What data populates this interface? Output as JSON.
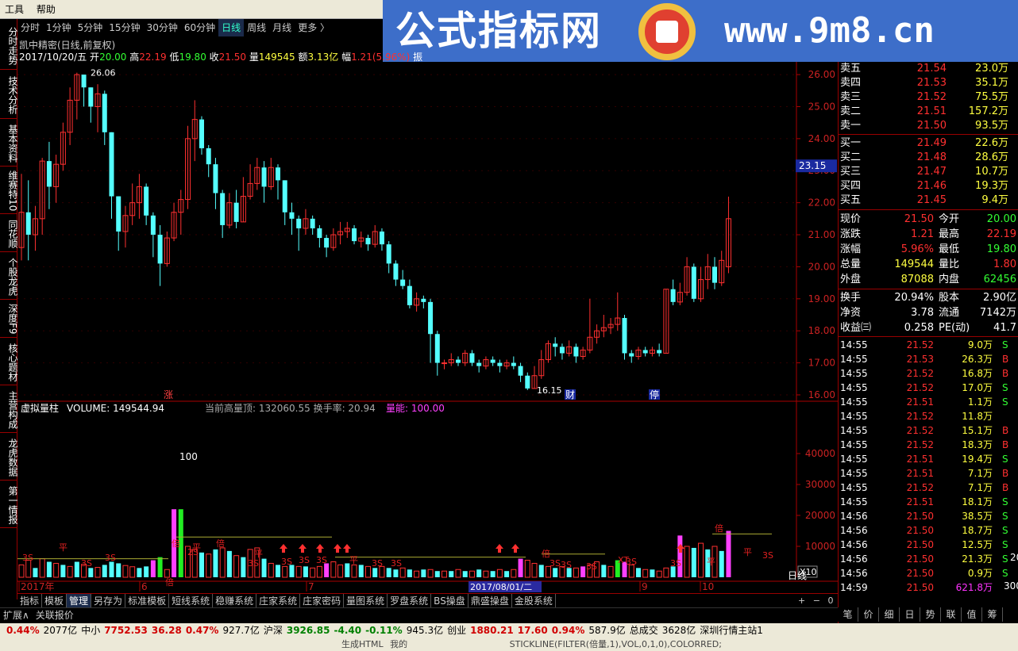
{
  "menu": [
    "工具",
    "帮助"
  ],
  "banner": {
    "cn": "公式指标网",
    "url": "www.9m8.cn",
    "logo_text": "www.9m8.cn"
  },
  "left_tabs": [
    "分时走势",
    "技术分析",
    "基本资料",
    "维赛特10",
    "同花顺",
    "个股龙虎",
    "深度F9",
    "核心题材",
    "主营构成",
    "龙虎数据",
    "第一情报"
  ],
  "timeframes": [
    "分时",
    "1分钟",
    "5分钟",
    "15分钟",
    "30分钟",
    "60分钟",
    "日线",
    "周线",
    "月线",
    "更多 〉"
  ],
  "active_timeframe": "日线",
  "stock_title": "凯中精密(日线,前复权)",
  "info": {
    "date": "2017/10/20/五",
    "open_l": "开",
    "open": "20.00",
    "high_l": "高",
    "high": "22.19",
    "low_l": "低",
    "low": "19.80",
    "close_l": "收",
    "close": "21.50",
    "vol_l": "量",
    "vol": "149545",
    "amt_l": "额",
    "amt": "3.13亿",
    "chg_l": "幅",
    "chg": "1.21(5.96%)",
    "extra": "振"
  },
  "price_axis": [
    "26.00",
    "25.00",
    "24.00",
    "23.00",
    "22.00",
    "21.00",
    "20.00",
    "19.00",
    "18.00",
    "17.00",
    "16.00"
  ],
  "current_price_tag": "23.15",
  "annot": {
    "high": "26.06",
    "low": "16.15",
    "zhang": "涨",
    "cai": "财",
    "ting": "停",
    "hundred": "100"
  },
  "volume_header": {
    "name": "虚拟量柱",
    "vol": "VOLUME: 149544.94",
    "mid": "当前高量顶: 132060.55  换手率: 20.94",
    "lianneng": "量能: 100.00"
  },
  "volume_axis": [
    "40000",
    "30000",
    "20000",
    "10000"
  ],
  "x10": "X10",
  "dates": {
    "d1": "2017年",
    "d2": "6",
    "d3": "7",
    "d4": "2017/08/01/二",
    "d5": "9",
    "d6": "10"
  },
  "vol_labels": [
    "3S",
    "平",
    "3S",
    "3S",
    "倍",
    "倍",
    "2S",
    "平",
    "倍",
    "3S",
    "平",
    "3S",
    "3S",
    "3S",
    "平",
    "3S",
    "3S",
    "倍",
    "3S",
    "3S",
    "3S",
    "XT",
    "3S",
    "3S",
    "平",
    "倍",
    "平",
    "3S"
  ],
  "chart_data": {
    "type": "candlestick",
    "ylim": [
      16,
      26.06
    ],
    "candles": [
      [
        20.6,
        21.7,
        20.2,
        22.9
      ],
      [
        21.7,
        21.0,
        20.2,
        22.7
      ],
      [
        21.0,
        21.5,
        20.5,
        21.9
      ],
      [
        21.5,
        23.3,
        21.0,
        23.4
      ],
      [
        23.3,
        22.5,
        21.8,
        23.9
      ],
      [
        22.5,
        23.2,
        22.0,
        23.5
      ],
      [
        23.2,
        24.2,
        23.0,
        24.5
      ],
      [
        24.2,
        25.2,
        23.8,
        25.6
      ],
      [
        25.2,
        26.0,
        24.6,
        26.06
      ],
      [
        26.0,
        25.6,
        25.0,
        26.0
      ],
      [
        25.6,
        25.0,
        24.5,
        25.6
      ],
      [
        25.0,
        25.4,
        24.2,
        25.7
      ],
      [
        25.4,
        24.2,
        23.8,
        25.5
      ],
      [
        24.2,
        22.2,
        21.5,
        24.2
      ],
      [
        22.2,
        21.1,
        20.5,
        22.2
      ],
      [
        21.1,
        21.6,
        20.6,
        21.9
      ],
      [
        21.6,
        22.0,
        21.3,
        22.6
      ],
      [
        22.0,
        22.5,
        21.5,
        22.9
      ],
      [
        22.5,
        21.6,
        21.3,
        22.6
      ],
      [
        21.6,
        21.0,
        20.3,
        21.7
      ],
      [
        21.0,
        20.1,
        19.4,
        21.3
      ],
      [
        20.1,
        20.9,
        20.0,
        21.1
      ],
      [
        20.9,
        21.7,
        20.8,
        22.0
      ],
      [
        21.7,
        22.1,
        21.0,
        22.4
      ],
      [
        22.1,
        24.0,
        21.8,
        24.4
      ],
      [
        24.0,
        24.6,
        23.3,
        25.2
      ],
      [
        24.6,
        23.7,
        23.5,
        24.7
      ],
      [
        23.7,
        23.2,
        22.8,
        23.8
      ],
      [
        23.2,
        22.3,
        21.8,
        23.4
      ],
      [
        22.3,
        21.3,
        20.9,
        22.4
      ],
      [
        21.3,
        22.0,
        21.2,
        22.3
      ],
      [
        22.0,
        21.4,
        21.2,
        22.4
      ],
      [
        21.4,
        22.2,
        21.4,
        22.8
      ],
      [
        22.2,
        22.6,
        22.1,
        23.2
      ],
      [
        22.6,
        23.1,
        22.4,
        23.4
      ],
      [
        23.1,
        22.5,
        22.0,
        23.3
      ],
      [
        22.5,
        23.1,
        22.4,
        23.4
      ],
      [
        23.1,
        22.7,
        22.1,
        23.2
      ],
      [
        22.7,
        21.7,
        21.3,
        22.7
      ],
      [
        21.7,
        21.5,
        21.0,
        22.0
      ],
      [
        21.5,
        21.2,
        20.5,
        21.6
      ],
      [
        21.2,
        21.5,
        21.0,
        21.8
      ],
      [
        21.5,
        21.2,
        21.0,
        21.6
      ],
      [
        21.2,
        20.9,
        20.6,
        21.3
      ],
      [
        20.9,
        20.6,
        20.3,
        21.0
      ],
      [
        20.6,
        21.0,
        20.5,
        21.2
      ],
      [
        21.0,
        21.1,
        20.7,
        21.4
      ],
      [
        21.1,
        21.2,
        20.9,
        21.4
      ],
      [
        21.2,
        20.8,
        20.7,
        21.3
      ],
      [
        20.8,
        20.9,
        20.6,
        21.1
      ],
      [
        20.9,
        20.7,
        20.5,
        21.0
      ],
      [
        20.7,
        21.1,
        20.6,
        21.3
      ],
      [
        21.1,
        20.7,
        20.5,
        21.2
      ],
      [
        20.7,
        20.1,
        19.8,
        20.8
      ],
      [
        20.1,
        19.6,
        19.4,
        20.2
      ],
      [
        19.6,
        19.4,
        19.3,
        19.9
      ],
      [
        19.4,
        18.8,
        18.7,
        19.6
      ],
      [
        18.8,
        19.0,
        18.6,
        19.2
      ],
      [
        19.0,
        18.9,
        18.7,
        19.1
      ],
      [
        18.9,
        17.9,
        17.0,
        19.0
      ],
      [
        17.9,
        17.0,
        16.6,
        18.0
      ],
      [
        17.0,
        17.0,
        16.8,
        17.1
      ],
      [
        17.0,
        17.1,
        16.9,
        17.3
      ],
      [
        17.1,
        17.0,
        16.9,
        17.2
      ],
      [
        17.0,
        17.3,
        16.9,
        17.4
      ],
      [
        17.3,
        17.0,
        16.9,
        17.4
      ],
      [
        17.0,
        16.9,
        16.7,
        17.1
      ],
      [
        16.9,
        17.1,
        16.8,
        17.2
      ],
      [
        17.1,
        17.0,
        16.9,
        17.2
      ],
      [
        17.0,
        16.9,
        16.7,
        17.1
      ],
      [
        16.9,
        17.0,
        16.8,
        17.1
      ],
      [
        17.0,
        16.9,
        16.8,
        17.2
      ],
      [
        16.9,
        16.6,
        16.4,
        17.0
      ],
      [
        16.6,
        16.2,
        16.15,
        16.7
      ],
      [
        16.2,
        16.6,
        16.2,
        16.9
      ],
      [
        16.6,
        17.1,
        16.5,
        17.4
      ],
      [
        17.1,
        17.6,
        17.0,
        17.7
      ],
      [
        17.6,
        17.5,
        17.2,
        17.8
      ],
      [
        17.5,
        17.3,
        17.1,
        17.6
      ],
      [
        17.3,
        17.5,
        17.2,
        17.7
      ],
      [
        17.5,
        17.2,
        17.0,
        17.6
      ],
      [
        17.2,
        17.4,
        17.1,
        17.5
      ],
      [
        17.4,
        17.8,
        17.3,
        19.0
      ],
      [
        17.8,
        18.0,
        17.6,
        18.2
      ],
      [
        18.0,
        18.1,
        17.8,
        18.5
      ],
      [
        18.1,
        18.2,
        17.9,
        18.4
      ],
      [
        18.2,
        18.4,
        18.0,
        19.2
      ],
      [
        18.4,
        17.3,
        17.1,
        18.5
      ],
      [
        17.3,
        17.2,
        17.0,
        17.4
      ],
      [
        17.2,
        17.4,
        17.1,
        17.5
      ],
      [
        17.4,
        17.3,
        17.2,
        17.5
      ],
      [
        17.3,
        17.4,
        17.2,
        17.5
      ],
      [
        17.4,
        17.3,
        17.2,
        17.6
      ],
      [
        17.3,
        19.3,
        17.3,
        19.3
      ],
      [
        19.3,
        18.9,
        18.8,
        19.6
      ],
      [
        18.9,
        19.2,
        18.8,
        19.5
      ],
      [
        19.2,
        20.0,
        19.1,
        20.3
      ],
      [
        20.0,
        19.0,
        18.9,
        20.1
      ],
      [
        19.0,
        19.6,
        18.9,
        20.0
      ],
      [
        19.6,
        20.0,
        19.3,
        20.4
      ],
      [
        20.0,
        19.5,
        19.3,
        20.3
      ],
      [
        19.5,
        20.2,
        19.4,
        20.5
      ],
      [
        20.0,
        21.5,
        19.8,
        22.19
      ]
    ],
    "volumes": [
      [
        4000,
        "up"
      ],
      [
        5500,
        "up"
      ],
      [
        3000,
        "dn"
      ],
      [
        6000,
        "up"
      ],
      [
        5000,
        "dn"
      ],
      [
        4500,
        "up"
      ],
      [
        4000,
        "dn"
      ],
      [
        3500,
        "up"
      ],
      [
        5000,
        "dn"
      ],
      [
        4200,
        "up"
      ],
      [
        3000,
        "dn"
      ],
      [
        3200,
        "up"
      ],
      [
        4000,
        "dn"
      ],
      [
        5000,
        "dn"
      ],
      [
        4500,
        "dn"
      ],
      [
        3800,
        "up"
      ],
      [
        3400,
        "up"
      ],
      [
        3000,
        "dn"
      ],
      [
        3500,
        "dn"
      ],
      [
        5500,
        "mg"
      ],
      [
        6500,
        "gr"
      ],
      [
        2500,
        "up"
      ],
      [
        22000,
        "mg"
      ],
      [
        22000,
        "gr"
      ],
      [
        10000,
        "up"
      ],
      [
        9000,
        "up"
      ],
      [
        8000,
        "dn"
      ],
      [
        7500,
        "up"
      ],
      [
        9000,
        "dn"
      ],
      [
        9500,
        "up"
      ],
      [
        8500,
        "dn"
      ],
      [
        7000,
        "up"
      ],
      [
        6500,
        "dn"
      ],
      [
        9000,
        "up"
      ],
      [
        9500,
        "up"
      ],
      [
        6000,
        "dn"
      ],
      [
        4500,
        "up"
      ],
      [
        4000,
        "dn"
      ],
      [
        3500,
        "up"
      ],
      [
        4000,
        "dn"
      ],
      [
        3500,
        "up"
      ],
      [
        3500,
        "dn"
      ],
      [
        3000,
        "up"
      ],
      [
        3500,
        "up"
      ],
      [
        4500,
        "mg"
      ],
      [
        5000,
        "up"
      ],
      [
        4000,
        "up"
      ],
      [
        4500,
        "dn"
      ],
      [
        4000,
        "up"
      ],
      [
        4000,
        "dn"
      ],
      [
        3500,
        "up"
      ],
      [
        3000,
        "dn"
      ],
      [
        3500,
        "up"
      ],
      [
        3000,
        "dn"
      ],
      [
        2500,
        "dn"
      ],
      [
        3000,
        "up"
      ],
      [
        2500,
        "dn"
      ],
      [
        2000,
        "up"
      ],
      [
        2500,
        "dn"
      ],
      [
        2500,
        "up"
      ],
      [
        2000,
        "dn"
      ],
      [
        2000,
        "up"
      ],
      [
        2000,
        "dn"
      ],
      [
        2500,
        "up"
      ],
      [
        2000,
        "dn"
      ],
      [
        2000,
        "up"
      ],
      [
        2500,
        "dn"
      ],
      [
        2000,
        "up"
      ],
      [
        2000,
        "dn"
      ],
      [
        2500,
        "up"
      ],
      [
        2000,
        "dn"
      ],
      [
        2500,
        "up"
      ],
      [
        6000,
        "mg"
      ],
      [
        5500,
        "up"
      ],
      [
        4500,
        "up"
      ],
      [
        4000,
        "dn"
      ],
      [
        3500,
        "up"
      ],
      [
        3000,
        "dn"
      ],
      [
        3500,
        "up"
      ],
      [
        3000,
        "dn"
      ],
      [
        3000,
        "up"
      ],
      [
        3500,
        "mg"
      ],
      [
        4000,
        "up"
      ],
      [
        5000,
        "up"
      ],
      [
        4000,
        "dn"
      ],
      [
        3500,
        "up"
      ],
      [
        5500,
        "gr"
      ],
      [
        5000,
        "mg"
      ],
      [
        4000,
        "up"
      ],
      [
        3000,
        "dn"
      ],
      [
        2500,
        "up"
      ],
      [
        2500,
        "dn"
      ],
      [
        2000,
        "up"
      ],
      [
        3000,
        "up"
      ],
      [
        3500,
        "dn"
      ],
      [
        13500,
        "mg"
      ],
      [
        10000,
        "up"
      ],
      [
        9500,
        "dn"
      ],
      [
        11000,
        "up"
      ],
      [
        9000,
        "dn"
      ],
      [
        10000,
        "up"
      ],
      [
        8500,
        "dn"
      ],
      [
        15000,
        "mg"
      ]
    ]
  },
  "orderbook": [
    {
      "label": "卖五",
      "price": "21.54",
      "vol": "23.0万"
    },
    {
      "label": "卖四",
      "price": "21.53",
      "vol": "35.1万"
    },
    {
      "label": "卖三",
      "price": "21.52",
      "vol": "75.5万"
    },
    {
      "label": "卖二",
      "price": "21.51",
      "vol": "157.2万"
    },
    {
      "label": "卖一",
      "price": "21.50",
      "vol": "93.5万"
    },
    {
      "label": "买一",
      "price": "21.49",
      "vol": "22.6万"
    },
    {
      "label": "买二",
      "price": "21.48",
      "vol": "28.6万"
    },
    {
      "label": "买三",
      "price": "21.47",
      "vol": "10.7万"
    },
    {
      "label": "买四",
      "price": "21.46",
      "vol": "19.3万"
    },
    {
      "label": "买五",
      "price": "21.45",
      "vol": "9.4万"
    }
  ],
  "quote": [
    {
      "l1": "现价",
      "v1": "21.50",
      "l2": "今开",
      "v2": "20.00"
    },
    {
      "l1": "涨跌",
      "v1": "1.21",
      "l2": "最高",
      "v2": "22.19"
    },
    {
      "l1": "涨幅",
      "v1": "5.96%",
      "l2": "最低",
      "v2": "19.80"
    },
    {
      "l1": "总量",
      "v1": "149544",
      "l2": "量比",
      "v2": "1.80"
    },
    {
      "l1": "外盘",
      "v1": "87088",
      "l2": "内盘",
      "v2": "62456"
    },
    {
      "l1": "换手",
      "v1": "20.94%",
      "l2": "股本",
      "v2": "2.90亿"
    },
    {
      "l1": "净资",
      "v1": "3.78",
      "l2": "流通",
      "v2": "7142万"
    },
    {
      "l1": "收益㈢",
      "v1": "0.258",
      "l2": "PE(动)",
      "v2": "41.7"
    }
  ],
  "ticks": [
    [
      "14:55",
      "21.52",
      "9.0万",
      "S"
    ],
    [
      "14:55",
      "21.53",
      "26.3万",
      "B"
    ],
    [
      "14:55",
      "21.52",
      "16.8万",
      "B"
    ],
    [
      "14:55",
      "21.52",
      "17.0万",
      "S"
    ],
    [
      "14:55",
      "21.51",
      "1.1万",
      "S"
    ],
    [
      "14:55",
      "21.52",
      "11.8万",
      ""
    ],
    [
      "14:55",
      "21.52",
      "15.1万",
      "B"
    ],
    [
      "14:55",
      "21.52",
      "18.3万",
      "B"
    ],
    [
      "14:55",
      "21.51",
      "19.4万",
      "S"
    ],
    [
      "14:55",
      "21.51",
      "7.1万",
      "B"
    ],
    [
      "14:55",
      "21.52",
      "7.1万",
      "B"
    ],
    [
      "14:55",
      "21.51",
      "18.1万",
      "S"
    ],
    [
      "14:56",
      "21.50",
      "38.5万",
      "S"
    ],
    [
      "14:56",
      "21.50",
      "18.7万",
      "S"
    ],
    [
      "14:56",
      "21.50",
      "12.5万",
      "S"
    ],
    [
      "14:56",
      "21.50",
      "21.3万",
      "S"
    ],
    [
      "14:56",
      "21.50",
      "0.9万",
      "S"
    ],
    [
      "14:59",
      "21.50",
      "621.8万",
      ""
    ]
  ],
  "tick_extra": {
    "row15": "20",
    "row17": "300"
  },
  "bottom_tabs": [
    "指标",
    "模板",
    "管理",
    "另存为",
    "标准模板",
    "短线系统",
    "稳赚系统",
    "庄家系统",
    "庄家密码",
    "量图系统",
    "罗盘系统",
    "BS操盘",
    "鼎盛操盘",
    "金股系统"
  ],
  "bottom_tabs2": [
    "扩展∧",
    "关联报价"
  ],
  "right_tail": {
    "period": "日线",
    "plus": "+",
    "minus": "−",
    "zero": "0"
  },
  "right_tabs": [
    "笔",
    "价",
    "细",
    "日",
    "势",
    "联",
    "值",
    "筹"
  ],
  "status": [
    {
      "t": "0.44%",
      "c": "red"
    },
    {
      "t": "2077亿",
      "c": "blk"
    },
    {
      "t": "中小",
      "c": "blk"
    },
    {
      "t": "7752.53",
      "c": "red"
    },
    {
      "t": "36.28",
      "c": "red"
    },
    {
      "t": "0.47%",
      "c": "red"
    },
    {
      "t": "927.7亿",
      "c": "blk"
    },
    {
      "t": "沪深",
      "c": "blk"
    },
    {
      "t": "3926.85",
      "c": "grn"
    },
    {
      "t": "-4.40",
      "c": "grn"
    },
    {
      "t": "-0.11%",
      "c": "grn"
    },
    {
      "t": "945.3亿",
      "c": "blk"
    },
    {
      "t": "创业",
      "c": "blk"
    },
    {
      "t": "1880.21",
      "c": "red"
    },
    {
      "t": "17.60",
      "c": "red"
    },
    {
      "t": "0.94%",
      "c": "red"
    },
    {
      "t": "587.9亿",
      "c": "blk"
    },
    {
      "t": "总成交",
      "c": "blk"
    },
    {
      "t": "3628亿",
      "c": "blk"
    },
    {
      "t": "深圳行情主站1",
      "c": "blk"
    }
  ],
  "status2": {
    "a": "生成HTML",
    "b": "我的",
    "c": "STICKLINE(FILTER(倍量,1),VOL,0,1,0),COLORRED;"
  },
  "colors": {
    "up": "#ff3030",
    "down": "#54ffff",
    "magenta": "#ff40ff",
    "green": "#22ee22",
    "axis": "#aa0000"
  }
}
